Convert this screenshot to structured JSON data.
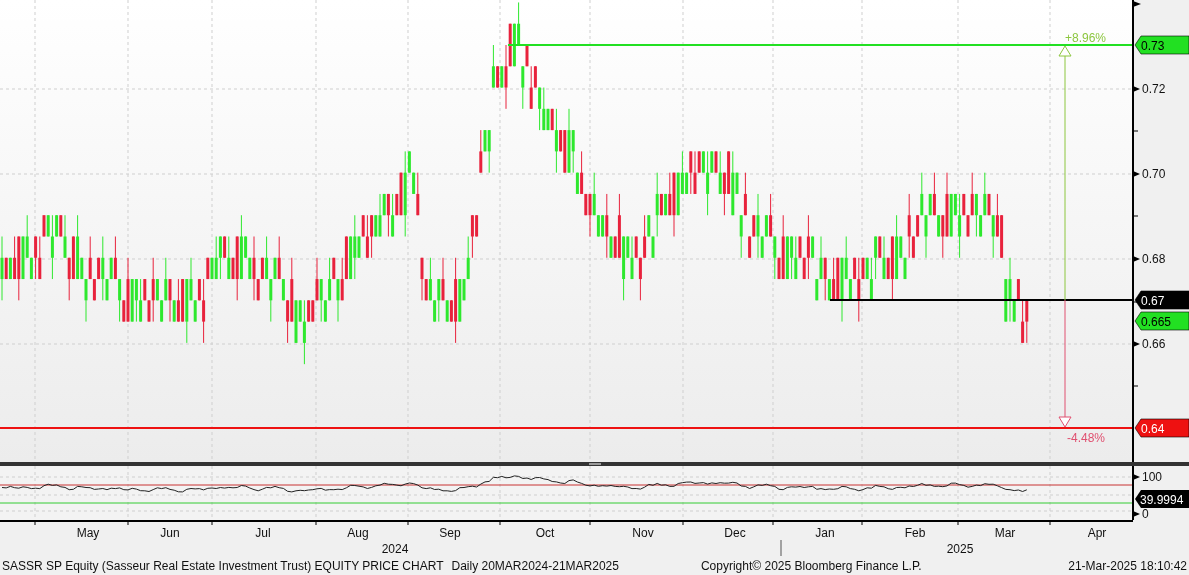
{
  "price_axis": {
    "ticks": [
      "0.72",
      "0.70",
      "0.68",
      "0.66"
    ]
  },
  "price_markers": [
    {
      "label": "0.73",
      "color": "#22e022"
    },
    {
      "label": "0.67",
      "color": "#000000"
    },
    {
      "label": "0.665",
      "color": "#22e022"
    },
    {
      "label": "0.64",
      "color": "#ee1111"
    }
  ],
  "range_measure": {
    "up_label": "+8.96%",
    "down_label": "-4.48%"
  },
  "indicator_panel": {
    "axis_ticks": [
      "100",
      "0"
    ],
    "marker": {
      "label": "39.9994"
    }
  },
  "time_axis": {
    "months": [
      "May",
      "Jun",
      "Jul",
      "Aug",
      "Sep",
      "Oct",
      "Nov",
      "Dec",
      "Jan",
      "Feb",
      "Mar",
      "Apr"
    ],
    "years": [
      "2024",
      "2025"
    ]
  },
  "footer": {
    "description": "SASSR SP Equity (Sasseur Real Estate Investment Trust) EQUITY PRICE CHART",
    "range": "Daily 20MAR2024-21MAR2025",
    "copyright": "Copyright© 2025 Bloomberg Finance L.P.",
    "timestamp": "21-Mar-2025 18:10:42"
  }
}
